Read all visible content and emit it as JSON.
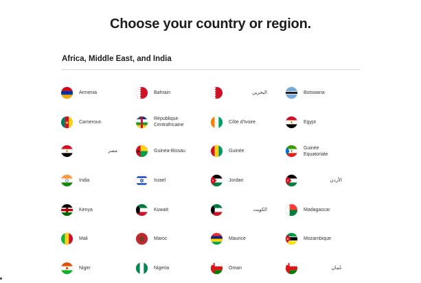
{
  "page": {
    "title": "Choose your country or region."
  },
  "section": {
    "title": "Africa, Middle East, and India"
  },
  "countries": [
    {
      "label": "Armenia",
      "flag": "armenia-flag"
    },
    {
      "label": "Bahrain",
      "flag": "bahrain-flag"
    },
    {
      "label": "البحرين",
      "flag": "bahrain-flag"
    },
    {
      "label": "Botswana",
      "flag": "botswana-flag"
    },
    {
      "label": "Cameroun",
      "flag": "cameroon-flag"
    },
    {
      "label": "République\nCentrafricaine",
      "flag": "central-african-republic-flag"
    },
    {
      "label": "Côte d'Ivoire",
      "flag": "cote-divoire-flag"
    },
    {
      "label": "Egypt",
      "flag": "egypt-flag"
    },
    {
      "label": "مصر",
      "flag": "egypt-flag"
    },
    {
      "label": "Guinea-Bissau",
      "flag": "guinea-bissau-flag"
    },
    {
      "label": "Guinée",
      "flag": "guinea-flag"
    },
    {
      "label": "Guinée\nEquatoriale",
      "flag": "equatorial-guinea-flag"
    },
    {
      "label": "India",
      "flag": "india-flag"
    },
    {
      "label": "Israel",
      "flag": "israel-flag"
    },
    {
      "label": "Jordan",
      "flag": "jordan-flag"
    },
    {
      "label": "الأردن",
      "flag": "jordan-flag"
    },
    {
      "label": "Kenya",
      "flag": "kenya-flag"
    },
    {
      "label": "Kuwait",
      "flag": "kuwait-flag"
    },
    {
      "label": "الكويت",
      "flag": "kuwait-flag"
    },
    {
      "label": "Madagascar",
      "flag": "madagascar-flag"
    },
    {
      "label": "Mali",
      "flag": "mali-flag"
    },
    {
      "label": "Maroc",
      "flag": "morocco-flag"
    },
    {
      "label": "Maurice",
      "flag": "mauritius-flag"
    },
    {
      "label": "Mozambique",
      "flag": "mozambique-flag"
    },
    {
      "label": "Niger",
      "flag": "niger-flag"
    },
    {
      "label": "Nigeria",
      "flag": "nigeria-flag"
    },
    {
      "label": "Oman",
      "flag": "oman-flag"
    },
    {
      "label": "عُمان",
      "flag": "oman-flag"
    }
  ]
}
